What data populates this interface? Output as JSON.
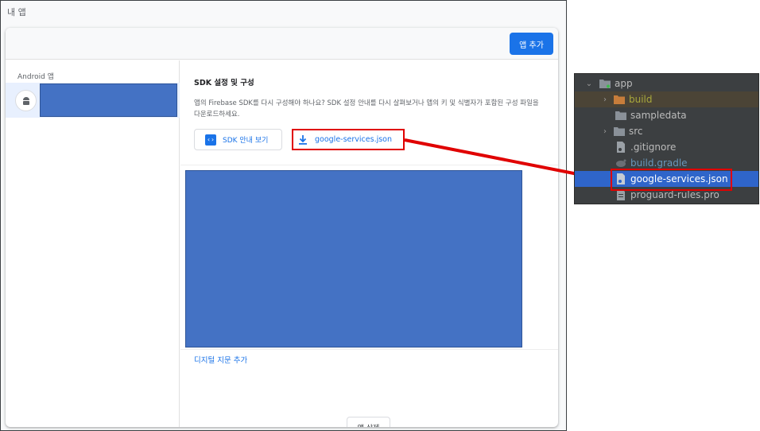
{
  "console": {
    "title": "내 앱",
    "add_app_button": "앱 추가",
    "sidebar": {
      "heading": "Android 앱"
    },
    "section": {
      "title": "SDK 설정 및 구성",
      "description": "앱의 Firebase SDK를 다시 구성해야 하나요? SDK 설정 안내를 다시 살펴보거나 앱의 키 및 식별자가 포함된 구성 파일을 다운로드하세요."
    },
    "buttons": {
      "sdk_guide": "SDK 안내 보기",
      "download_json": "google-services.json",
      "delete_app": "앱 삭제"
    },
    "links": {
      "add_fingerprint": "디지털 지문 추가"
    }
  },
  "project_tree": {
    "items": [
      {
        "label": "app",
        "icon": "module-folder-icon",
        "expanded": true
      },
      {
        "label": "build",
        "icon": "folder-icon",
        "color": "#c77d3b",
        "label_color": "#a8a83c"
      },
      {
        "label": "sampledata",
        "icon": "folder-icon"
      },
      {
        "label": "src",
        "icon": "folder-icon"
      },
      {
        "label": ".gitignore",
        "icon": "file-icon"
      },
      {
        "label": "build.gradle",
        "icon": "gradle-icon",
        "label_color": "#6897bb"
      },
      {
        "label": "google-services.json",
        "icon": "json-file-icon",
        "selected": true
      },
      {
        "label": "proguard-rules.pro",
        "icon": "file-icon"
      }
    ]
  },
  "colors": {
    "primary": "#1a73e8",
    "redaction": "#4472c4",
    "annotation_red": "#e00000",
    "tree_bg": "#3c3f41",
    "tree_selected": "#2f65ca"
  }
}
